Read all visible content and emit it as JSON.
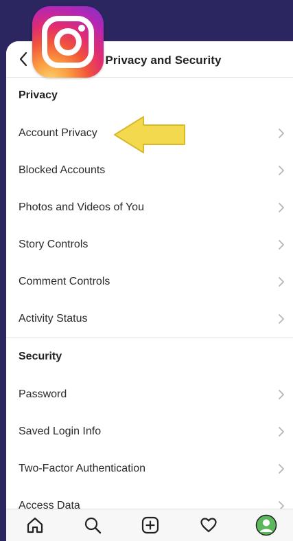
{
  "header": {
    "title": "Privacy and Security"
  },
  "privacy": {
    "title": "Privacy",
    "items": [
      {
        "label": "Account Privacy"
      },
      {
        "label": "Blocked Accounts"
      },
      {
        "label": "Photos and Videos of You"
      },
      {
        "label": "Story Controls"
      },
      {
        "label": "Comment Controls"
      },
      {
        "label": "Activity Status"
      }
    ]
  },
  "security": {
    "title": "Security",
    "items": [
      {
        "label": "Password"
      },
      {
        "label": "Saved Login Info"
      },
      {
        "label": "Two-Factor Authentication"
      },
      {
        "label": "Access Data"
      }
    ]
  },
  "bottom_nav": [
    "home-icon",
    "search-icon",
    "add-post-icon",
    "heart-icon",
    "profile-avatar-icon"
  ],
  "colors": {
    "background": "#2b2560",
    "highlight_arrow": "#f2d94e",
    "profile_green": "#5cb85c"
  }
}
